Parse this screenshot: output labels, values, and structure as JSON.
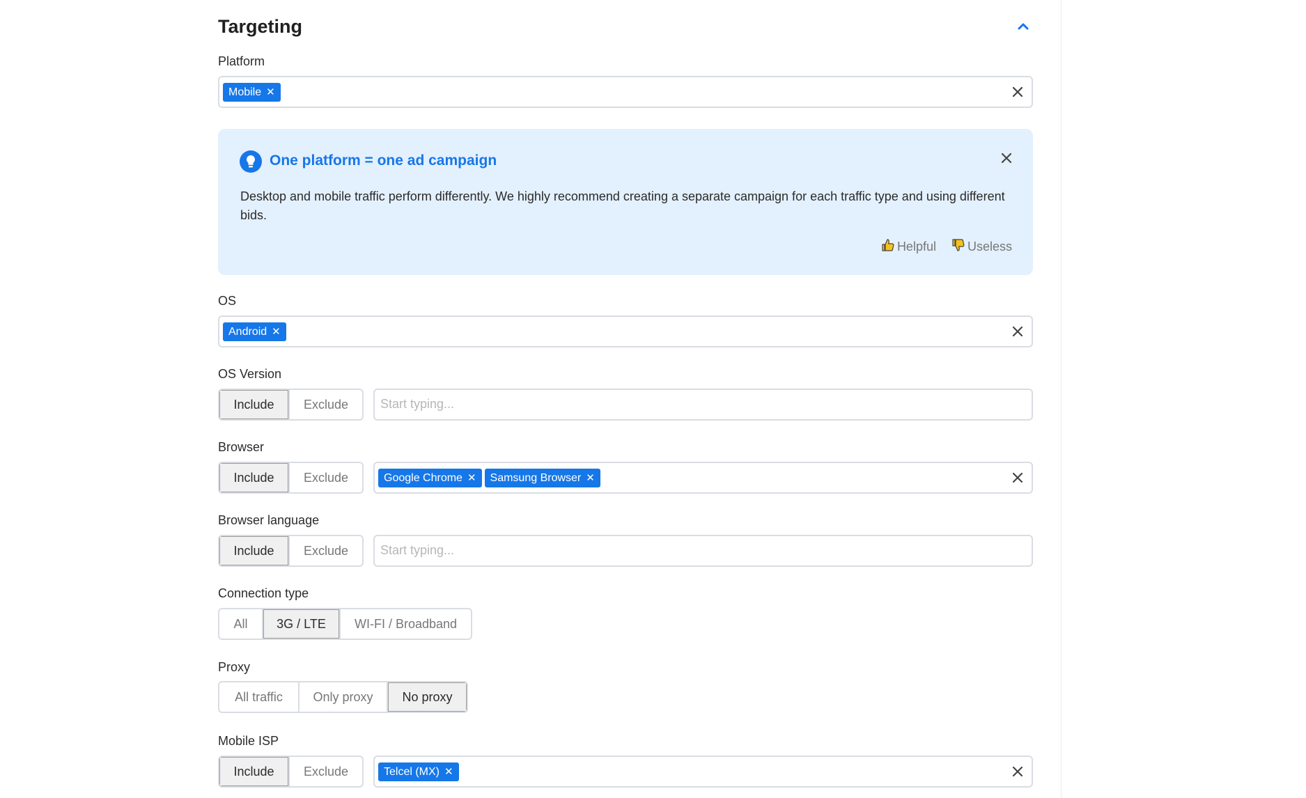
{
  "section": {
    "title": "Targeting"
  },
  "platform": {
    "label": "Platform",
    "tags": [
      "Mobile"
    ]
  },
  "info": {
    "title": "One platform = one ad campaign",
    "text": "Desktop and mobile traffic perform differently. We highly recommend creating a separate campaign for each traffic type and using different bids.",
    "helpful": "Helpful",
    "useless": "Useless"
  },
  "os": {
    "label": "OS",
    "tags": [
      "Android"
    ]
  },
  "os_version": {
    "label": "OS Version",
    "include": "Include",
    "exclude": "Exclude",
    "placeholder": "Start typing..."
  },
  "browser": {
    "label": "Browser",
    "include": "Include",
    "exclude": "Exclude",
    "tags": [
      "Google Chrome",
      "Samsung Browser"
    ]
  },
  "browser_language": {
    "label": "Browser language",
    "include": "Include",
    "exclude": "Exclude",
    "placeholder": "Start typing..."
  },
  "connection": {
    "label": "Connection type",
    "options": [
      "All",
      "3G / LTE",
      "WI-FI / Broadband"
    ],
    "selected": "3G / LTE"
  },
  "proxy": {
    "label": "Proxy",
    "options": [
      "All traffic",
      "Only proxy",
      "No proxy"
    ],
    "selected": "No proxy"
  },
  "mobile_isp": {
    "label": "Mobile ISP",
    "include": "Include",
    "exclude": "Exclude",
    "tags": [
      "Telcel (MX)"
    ]
  },
  "colors": {
    "accent": "#1677e8",
    "info_bg": "#e3f0fd",
    "border": "#d9dde3"
  },
  "icons": [
    "chevron-up-icon",
    "close-icon",
    "lightbulb-icon",
    "thumbs-up-icon",
    "thumbs-down-icon"
  ]
}
